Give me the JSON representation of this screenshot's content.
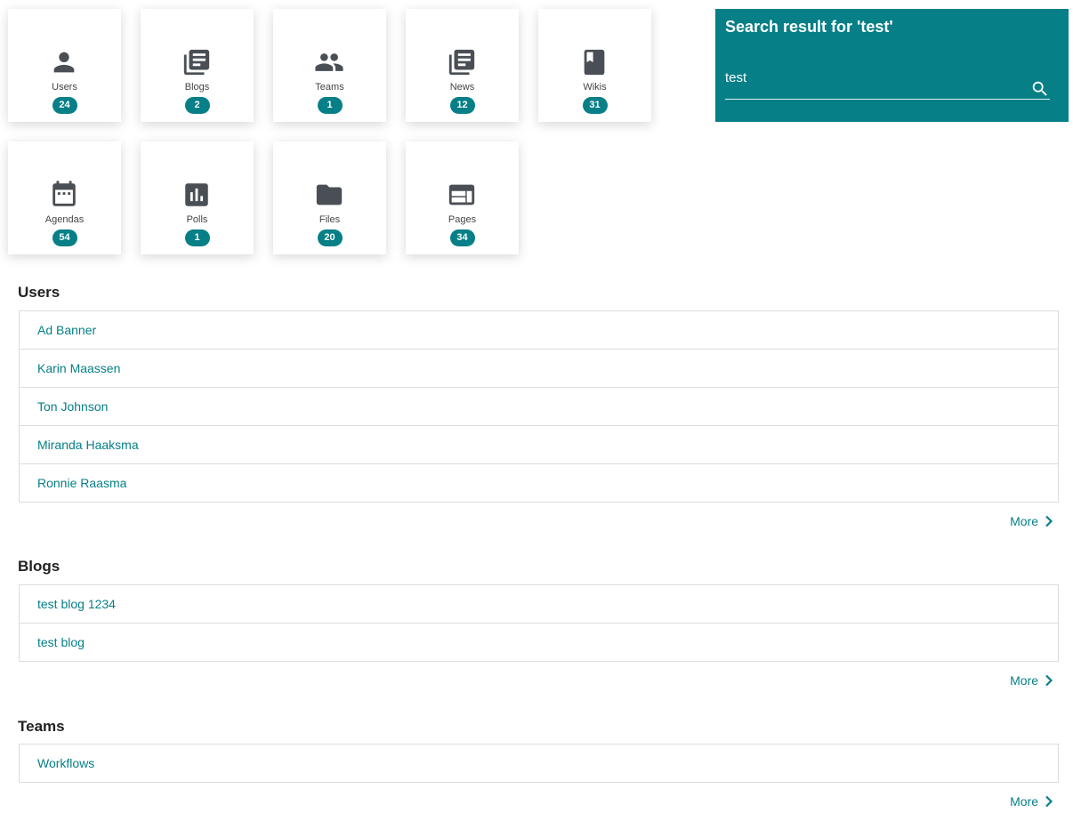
{
  "tiles": [
    {
      "label": "Users",
      "count": "24",
      "icon": "person-icon"
    },
    {
      "label": "Blogs",
      "count": "2",
      "icon": "blog-icon"
    },
    {
      "label": "Teams",
      "count": "1",
      "icon": "group-icon"
    },
    {
      "label": "News",
      "count": "12",
      "icon": "news-icon"
    },
    {
      "label": "Wikis",
      "count": "31",
      "icon": "book-icon"
    },
    {
      "label": "Agendas",
      "count": "54",
      "icon": "calendar-icon"
    },
    {
      "label": "Polls",
      "count": "1",
      "icon": "poll-icon"
    },
    {
      "label": "Files",
      "count": "20",
      "icon": "folder-icon"
    },
    {
      "label": "Pages",
      "count": "34",
      "icon": "page-layout-icon"
    }
  ],
  "search": {
    "title": "Search result for 'test'",
    "value": "test",
    "icon": "search-icon"
  },
  "sections": {
    "users": {
      "title": "Users",
      "items": [
        "Ad Banner",
        "Karin Maassen",
        "Ton Johnson",
        "Miranda Haaksma",
        "Ronnie Raasma"
      ],
      "more": "More"
    },
    "blogs": {
      "title": "Blogs",
      "items": [
        "test blog 1234",
        "test blog"
      ],
      "more": "More"
    },
    "teams": {
      "title": "Teams",
      "items": [
        "Workflows"
      ],
      "more": "More"
    }
  },
  "colors": {
    "accent": "#067f87",
    "icon": "#4a4f55"
  }
}
